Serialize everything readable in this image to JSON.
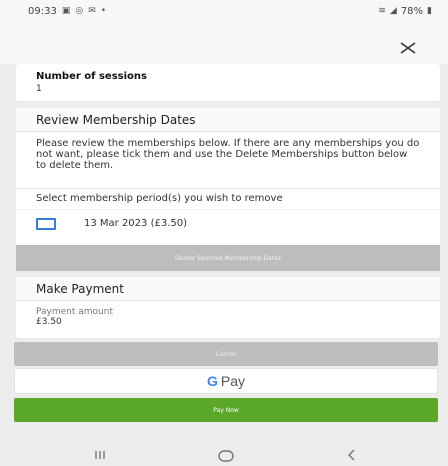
{
  "status": {
    "time": "09:33",
    "icons_left": [
      "image-icon",
      "cast-icon",
      "mail-icon",
      "dot-icon"
    ],
    "battery": "78%"
  },
  "sessions": {
    "label": "Number of sessions",
    "value": "1"
  },
  "review": {
    "title": "Review Membership Dates",
    "description": "Please review the memberships below. If there are any memberships you do not want, please tick them and use the Delete Memberships button below to delete them.",
    "select_label": "Select membership period(s) you wish to remove",
    "memberships": [
      {
        "label": "13 Mar 2023 (£3.50)",
        "checked": false
      }
    ],
    "delete_button": "Delete Selected Membership Dates"
  },
  "payment": {
    "title": "Make Payment",
    "amount_label": "Payment amount",
    "amount_value": "£3.50"
  },
  "actions": {
    "cancel": "Cancel",
    "gpay_g": "G",
    "gpay_label": "Pay",
    "pay_now": "Pay Now"
  },
  "colors": {
    "accent_green": "#5aa72a",
    "disabled_grey": "#bdbdbd",
    "checkbox_blue": "#3a7bd5"
  }
}
